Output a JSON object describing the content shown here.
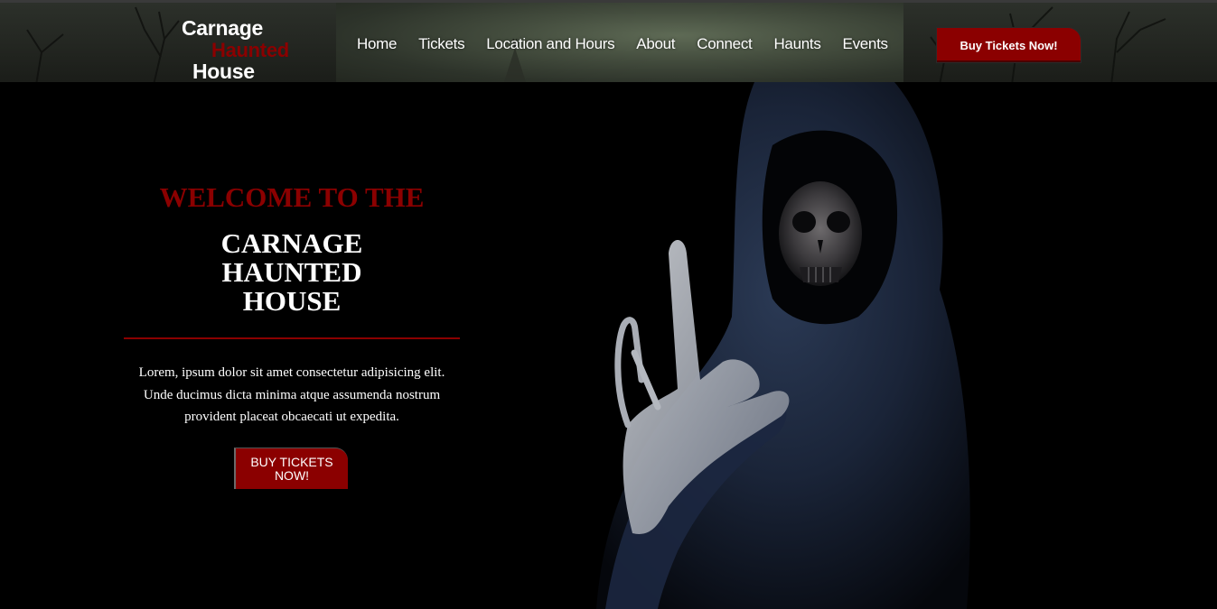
{
  "brand": {
    "line1": "Carnage",
    "line2": "Haunted",
    "line3": "House"
  },
  "nav": {
    "items": [
      "Home",
      "Tickets",
      "Location and Hours",
      "About",
      "Connect",
      "Haunts",
      "Events"
    ],
    "cta_label": "Buy Tickets Now!"
  },
  "hero": {
    "kicker": "WELCOME TO THE",
    "title_lines": [
      "CARNAGE",
      "HAUNTED",
      "HOUSE"
    ],
    "description_lines": [
      "Lorem, ipsum dolor sit amet consectetur adipisicing elit.",
      "Unde ducimus dicta minima atque assumenda nostrum",
      "provident placeat obcaecati ut expedita."
    ],
    "cta_label": "BUY TICKETS NOW!"
  },
  "colors": {
    "accent": "#8b0000",
    "background": "#000000",
    "text": "#ffffff"
  }
}
